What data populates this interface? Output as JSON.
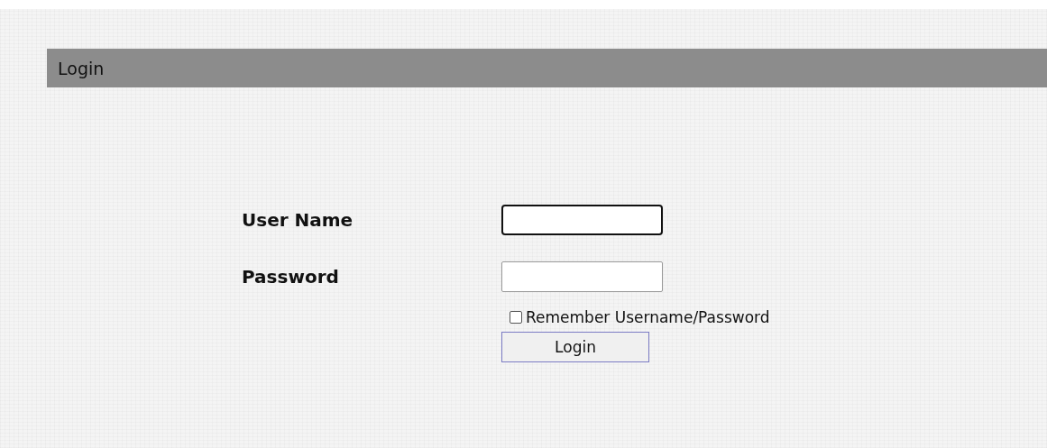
{
  "header": {
    "title": "Login"
  },
  "fields": [
    {
      "label": "User Name",
      "focused": true
    },
    {
      "label": "Password",
      "focused": false
    }
  ],
  "remember": {
    "label": "Remember Username/Password",
    "checked": false
  },
  "button": {
    "label": "Login"
  }
}
